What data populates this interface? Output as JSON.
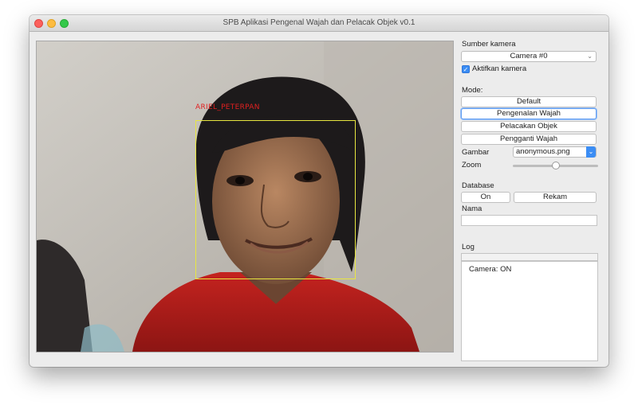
{
  "window": {
    "title": "SPB Aplikasi Pengenal Wajah dan Pelacak Objek v0.1"
  },
  "video": {
    "face_label": "ARIEL_PETERPAN"
  },
  "camera": {
    "section_label": "Sumber kamera",
    "selected": "Camera #0",
    "enable_label": "Aktifkan kamera",
    "enabled": true
  },
  "mode": {
    "section_label": "Mode:",
    "buttons": [
      "Default",
      "Pengenalan Wajah",
      "Pelacakan Objek",
      "Pengganti Wajah"
    ],
    "focused": "Pengenalan Wajah"
  },
  "image": {
    "label": "Gambar",
    "selected": "anonymous.png"
  },
  "zoom": {
    "label": "Zoom",
    "value": 0.5
  },
  "database": {
    "section_label": "Database",
    "on_label": "On",
    "record_label": "Rekam"
  },
  "name": {
    "label": "Nama",
    "value": ""
  },
  "log": {
    "label": "Log",
    "entries": [
      "Camera: ON"
    ]
  },
  "icons": {
    "check": "✓",
    "chevron": "⌄"
  }
}
